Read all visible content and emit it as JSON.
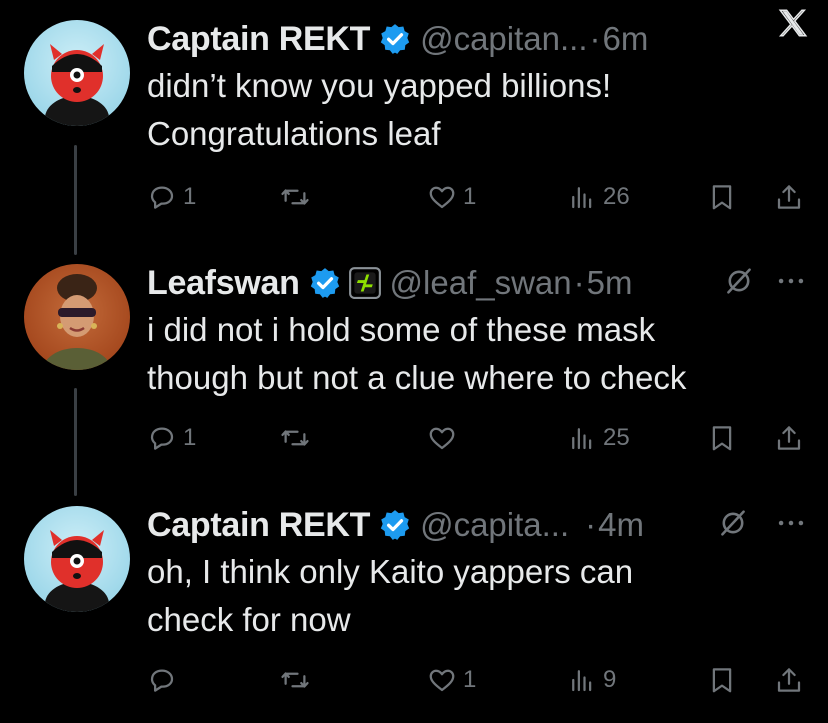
{
  "tweets": [
    {
      "name": "Captain REKT",
      "handle": "@capitan...",
      "time": "6m",
      "text_line1": "didn’t know you yapped billions!",
      "text_line2": "Congratulations leaf",
      "replies": "1",
      "retweets": "",
      "likes": "1",
      "views": "26"
    },
    {
      "name": "Leafswan",
      "handle": "@leaf_swan",
      "time": "5m",
      "text_line1": "i did not i hold some of these mask",
      "text_line2": "though but not a clue where to check",
      "replies": "1",
      "retweets": "",
      "likes": "",
      "views": "25"
    },
    {
      "name": "Captain REKT",
      "handle": "@capita...",
      "time": "4m",
      "text_line1": "oh, I think only Kaito yappers can",
      "text_line2": "check for now",
      "replies": "",
      "retweets": "",
      "likes": "1",
      "views": "9"
    }
  ],
  "separator": "·",
  "icons": [
    "x-logo-icon",
    "verified-badge-icon",
    "affiliate-badge-icon",
    "reply-icon",
    "retweet-icon",
    "like-icon",
    "views-icon",
    "bookmark-icon",
    "share-icon",
    "muted-icon",
    "more-icon"
  ],
  "colors": {
    "background": "#000000",
    "text": "#e7e9ea",
    "muted": "#71767b",
    "verified": "#1d9bf0"
  }
}
